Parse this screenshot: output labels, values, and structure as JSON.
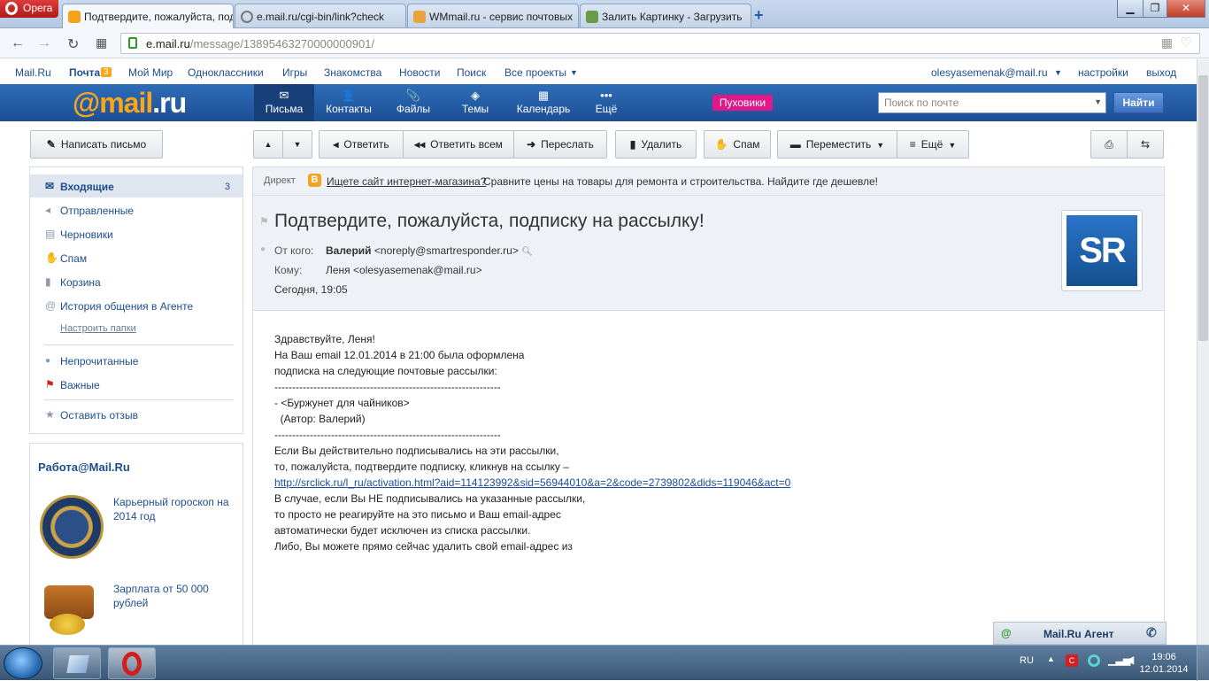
{
  "browser": {
    "opera_label": "Opera",
    "tabs": [
      {
        "title": "Подтвердите, пожалуйста, подписку на рассылку!"
      },
      {
        "title": "e.mail.ru/cgi-bin/link?check"
      },
      {
        "title": "WMmail.ru - сервис почтовых"
      },
      {
        "title": "Залить Картинку - Загрузить"
      }
    ],
    "new_tab": "+",
    "url_domain": "e.mail.ru",
    "url_path": "/message/13895463270000000901/"
  },
  "portal": {
    "links": [
      "Mail.Ru",
      "Почта",
      "Мой Мир",
      "Одноклассники",
      "Игры",
      "Знакомства",
      "Новости",
      "Поиск",
      "Все проекты"
    ],
    "mail_badge": "3",
    "user": "olesyasemenak@mail.ru",
    "settings": "настройки",
    "logout": "выход"
  },
  "header": {
    "logo_at": "@mail",
    "logo_ru": ".ru",
    "nav": [
      {
        "label": "Письма",
        "icon": "✉"
      },
      {
        "label": "Контакты",
        "icon": "👤"
      },
      {
        "label": "Файлы",
        "icon": "📎"
      },
      {
        "label": "Темы",
        "icon": "◈"
      },
      {
        "label": "Календарь",
        "icon": "▦"
      },
      {
        "label": "Ещё",
        "icon": "•••"
      }
    ],
    "promo": "Пуховики",
    "search_placeholder": "Поиск по почте",
    "search_button": "Найти"
  },
  "toolbar": {
    "compose": "Написать письмо",
    "reply": "Ответить",
    "reply_all": "Ответить всем",
    "forward": "Переслать",
    "delete": "Удалить",
    "spam": "Спам",
    "move": "Переместить",
    "more": "Ещё"
  },
  "folders": [
    {
      "label": "Входящие",
      "count": "3"
    },
    {
      "label": "Отправленные"
    },
    {
      "label": "Черновики"
    },
    {
      "label": "Спам"
    },
    {
      "label": "Корзина"
    },
    {
      "label": "История общения в Агенте"
    }
  ],
  "configure_folders": "Настроить папки",
  "filters": [
    {
      "label": "Непрочитанные"
    },
    {
      "label": "Важные"
    }
  ],
  "feedback": "Оставить отзыв",
  "work": {
    "title": "Работа@Mail.Ru",
    "item1": "Карьерный гороскоп на 2014 год",
    "item2": "Зарплата от 50 000 рублей"
  },
  "direct": {
    "label": "Директ",
    "link": "Ищете сайт интернет-магазина?",
    "text": "Сравните цены на товары для ремонта и строительства. Найдите где дешевле!"
  },
  "message": {
    "subject": "Подтвердите, пожалуйста, подписку на рассылку!",
    "from_label": "От кого:",
    "from_name": "Валерий",
    "from_email": "<noreply@smartresponder.ru>",
    "to_label": "Кому:",
    "to_value": "Леня <olesyasemenak@mail.ru>",
    "date": "Сегодня, 19:05",
    "avatar_text": "SR",
    "body": [
      "Здравствуйте, Леня!",
      "",
      "На Ваш email 12.01.2014 в 21:00 была оформлена",
      "подписка на следующие почтовые рассылки:",
      "----------------------------------------------------------------",
      "- <Буржунет для чайников>",
      "  (Автор: Валерий)",
      "----------------------------------------------------------------",
      "",
      "Если Вы действительно подписывались на эти рассылки,",
      "то, пожалуйста, подтвердите подписку, кликнув на ссылку –",
      ""
    ],
    "link": "http://srclick.ru/l_ru/activation.html?aid=114123992&sid=56944010&a=2&code=2739802&dids=119046&act=0",
    "body2": [
      "",
      "",
      "В случае, если Вы НЕ подписывались на указанные рассылки,",
      "то просто не реагируйте на это письмо и Ваш email-адрес",
      "автоматически будет исключен из списка рассылки.",
      "",
      "Либо, Вы можете прямо сейчас удалить свой email-адрес из"
    ]
  },
  "agent": {
    "label": "Mail.Ru Агент"
  },
  "taskbar": {
    "lang": "RU",
    "time": "19:06",
    "date": "12.01.2014"
  }
}
